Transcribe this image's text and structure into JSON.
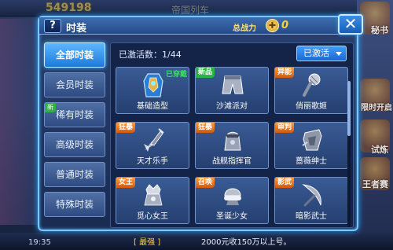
{
  "background": {
    "score": "549198",
    "title": "帝国列车",
    "right_buttons": [
      "秘书",
      "限时开启",
      "试炼",
      "王者赛"
    ],
    "time": "19:35",
    "chat_channel": "[ 最强 ]",
    "chat_text": "2000元收150万以上号。"
  },
  "window": {
    "help": "?",
    "title": "时装",
    "power_label": "总战力",
    "power_value": "0",
    "close": "✕"
  },
  "tabs": [
    {
      "label": "全部时装",
      "active": true,
      "new": false
    },
    {
      "label": "会员时装",
      "active": false,
      "new": false
    },
    {
      "label": "稀有时装",
      "active": false,
      "new": true
    },
    {
      "label": "高级时装",
      "active": false,
      "new": false
    },
    {
      "label": "普通时装",
      "active": false,
      "new": false
    },
    {
      "label": "特殊时装",
      "active": false,
      "new": false
    }
  ],
  "new_badge": "新",
  "panel": {
    "count_label": "已激活数：1/44",
    "filter": "已激活"
  },
  "cards": [
    {
      "name": "基础造型",
      "tag": "",
      "worn": "已穿戴",
      "icon": "armor-icon"
    },
    {
      "name": "沙滩派对",
      "tag": "新品",
      "tag_color": "green",
      "worn": "",
      "icon": "shorts-icon"
    },
    {
      "name": "俏丽歌姬",
      "tag": "异能",
      "tag_color": "orange",
      "worn": "",
      "icon": "microphone-icon"
    },
    {
      "name": "天才乐手",
      "tag": "狂暴",
      "tag_color": "orange",
      "worn": "",
      "icon": "guitar-icon"
    },
    {
      "name": "战舰指挥官",
      "tag": "狂暴",
      "tag_color": "orange",
      "worn": "",
      "icon": "captain-icon"
    },
    {
      "name": "蔷薇绅士",
      "tag": "审判",
      "tag_color": "orange",
      "worn": "",
      "icon": "gentleman-icon"
    },
    {
      "name": "觅心女王",
      "tag": "女王",
      "tag_color": "orange",
      "worn": "",
      "icon": "queen-icon"
    },
    {
      "name": "圣诞少女",
      "tag": "召唤",
      "tag_color": "orange",
      "worn": "",
      "icon": "santa-hat-icon"
    },
    {
      "name": "暗影武士",
      "tag": "影武",
      "tag_color": "orange",
      "worn": "",
      "icon": "blade-icon"
    }
  ],
  "colors": {
    "accent": "#48b8ff",
    "power": "#ffd43a",
    "tag_orange": "#e06a18",
    "tag_green": "#2db344"
  }
}
